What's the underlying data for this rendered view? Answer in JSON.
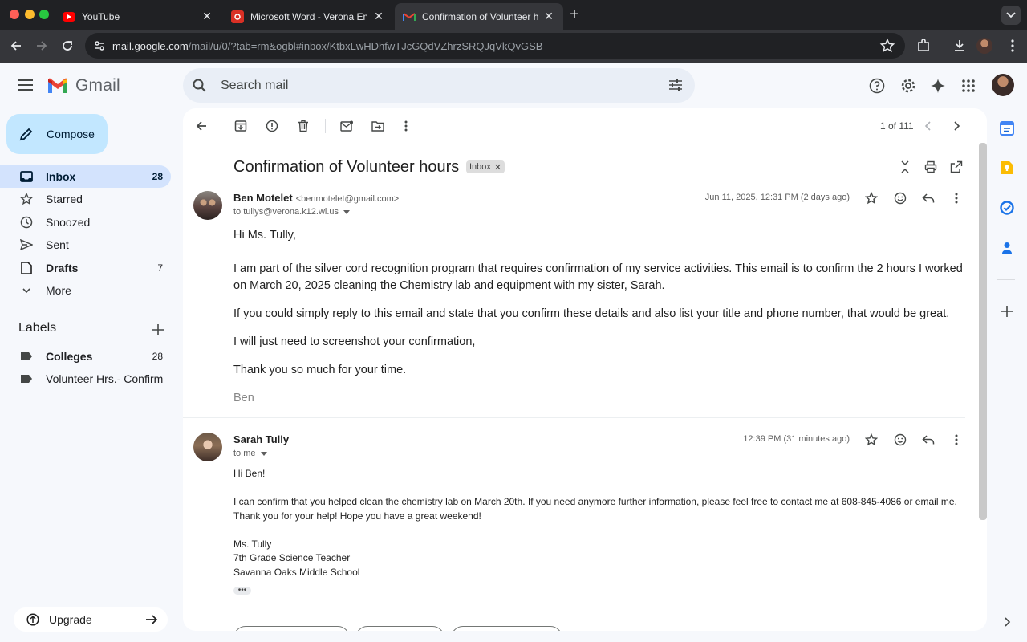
{
  "browser": {
    "tabs": [
      {
        "title": "YouTube",
        "icon": "youtube-icon"
      },
      {
        "title": "Microsoft Word - Verona Emp",
        "icon": "pdf-icon"
      },
      {
        "title": "Confirmation of Volunteer ho",
        "icon": "gmail-icon",
        "active": true
      }
    ],
    "url_host": "mail.google.com",
    "url_path": "/mail/u/0/?tab=rm&ogbl#inbox/KtbxLwHDhfwTJcGQdVZhrzSRQJqVkQvGSB"
  },
  "gmail": {
    "app_name": "Gmail",
    "search_placeholder": "Search mail",
    "compose_label": "Compose",
    "nav": [
      {
        "label": "Inbox",
        "count": "28",
        "icon": "inbox-icon"
      },
      {
        "label": "Starred",
        "count": "",
        "icon": "star-icon"
      },
      {
        "label": "Snoozed",
        "count": "",
        "icon": "clock-icon"
      },
      {
        "label": "Sent",
        "count": "",
        "icon": "send-icon"
      },
      {
        "label": "Drafts",
        "count": "7",
        "icon": "draft-icon"
      },
      {
        "label": "More",
        "count": "",
        "icon": "chevron-down-icon"
      }
    ],
    "labels_heading": "Labels",
    "labels": [
      {
        "label": "Colleges",
        "count": "28"
      },
      {
        "label": "Volunteer Hrs.- Confirm...",
        "count": ""
      }
    ],
    "upgrade_label": "Upgrade"
  },
  "thread": {
    "pager": "1 of 111",
    "subject": "Confirmation of Volunteer hours",
    "chip": "Inbox",
    "messages": [
      {
        "sender": "Ben Motelet",
        "email": "<benmotelet@gmail.com>",
        "to": "to tullys@verona.k12.wi.us",
        "date": "Jun 11, 2025, 12:31 PM (2 days ago)",
        "body": [
          "Hi Ms. Tully,",
          "I am part of the silver cord recognition program that requires confirmation of my service activities. This email is to confirm the 2 hours I worked on March 20, 2025 cleaning the Chemistry lab and equipment with my sister, Sarah.",
          "If you could simply reply to this email and state that you confirm these details and also list your title and phone number, that would be great.",
          "I will just need to screenshot your confirmation,",
          "Thank you so much for your time."
        ],
        "signature": "Ben"
      },
      {
        "sender": "Sarah Tully",
        "to": "to me",
        "date": "12:39 PM (31 minutes ago)",
        "body": [
          "Hi Ben!",
          "I can confirm that you helped clean the chemistry lab on March 20th. If you need anymore further information, please feel free to contact me at 608-845-4086 or email me. Thank you for your help! Hope you have a great weekend!",
          "Ms. Tully",
          "7th Grade Science Teacher",
          "Savanna Oaks Middle School"
        ],
        "trim_label": "•••"
      }
    ]
  },
  "colors": {
    "accent": "#0b57d0",
    "compose_bg": "#c2e7ff",
    "active_nav": "#d3e3fd",
    "page_bg": "#f6f8fc"
  }
}
